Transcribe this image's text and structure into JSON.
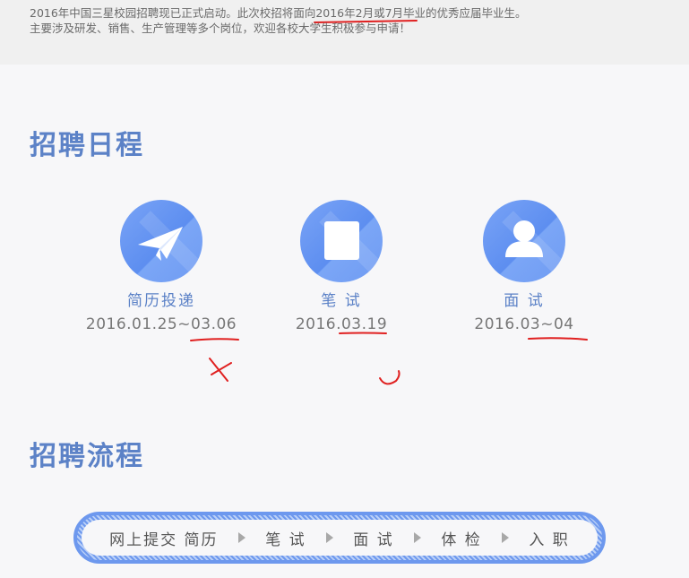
{
  "intro": {
    "line1_before": "2016年中国三星校园招聘现已正式启动。此次校招将面向",
    "line1_highlight": "2016年2月或7月毕",
    "line1_after": "业的优秀应届毕业生。",
    "line2": "主要涉及研发、销售、生产管理等多个岗位，欢迎各校大学生积极参与申请！"
  },
  "schedule": {
    "title": "招聘日程",
    "steps": [
      {
        "label": "简历投递",
        "date": "2016.01.25~03.06",
        "icon": "paper-plane-icon"
      },
      {
        "label": "笔 试",
        "date": "2016.03.19",
        "icon": "document-icon"
      },
      {
        "label": "面 试",
        "date": "2016.03~04",
        "icon": "person-icon"
      }
    ]
  },
  "process": {
    "title": "招聘流程",
    "items": [
      "网上提交 简历",
      "笔 试",
      "面 试",
      "体 检",
      "入 职"
    ]
  },
  "colors": {
    "accent": "#5c82c7",
    "circle": "#6d98ee",
    "annotation": "#e02020"
  }
}
